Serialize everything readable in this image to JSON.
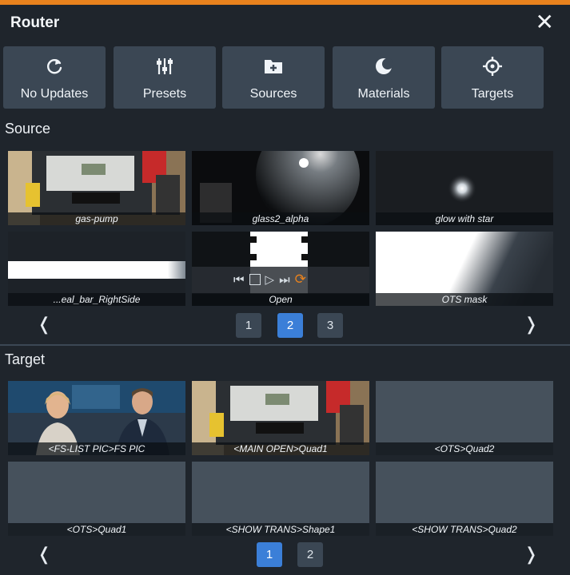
{
  "header": {
    "title": "Router",
    "close": "✕"
  },
  "toolbar": [
    {
      "label": "No Updates",
      "icon": "refresh-icon"
    },
    {
      "label": "Presets",
      "icon": "sliders-icon"
    },
    {
      "label": "Sources",
      "icon": "folder-add-icon"
    },
    {
      "label": "Materials",
      "icon": "moon-icon"
    },
    {
      "label": "Targets",
      "icon": "crosshair-icon"
    }
  ],
  "source": {
    "label": "Source",
    "items": [
      {
        "caption": "gas-pump"
      },
      {
        "caption": "glass2_alpha"
      },
      {
        "caption": "glow with star"
      },
      {
        "caption": "...eal_bar_RightSide"
      },
      {
        "caption": "Open"
      },
      {
        "caption": "OTS mask"
      }
    ],
    "pages": [
      "1",
      "2",
      "3"
    ],
    "active_page": "2"
  },
  "target": {
    "label": "Target",
    "items": [
      {
        "caption": "<FS-LIST PIC>FS PIC"
      },
      {
        "caption": "<MAIN OPEN>Quad1"
      },
      {
        "caption": "<OTS>Quad2"
      },
      {
        "caption": "<OTS>Quad1"
      },
      {
        "caption": "<SHOW TRANS>Shape1"
      },
      {
        "caption": "<SHOW TRANS>Quad2"
      }
    ],
    "pages": [
      "1",
      "2"
    ],
    "active_page": "1"
  },
  "pager": {
    "prev": "❬",
    "next": "❭"
  },
  "colors": {
    "accent": "#e8821d",
    "panel": "#1f252c",
    "button": "#3b4754",
    "active_page": "#3b7fd8"
  }
}
